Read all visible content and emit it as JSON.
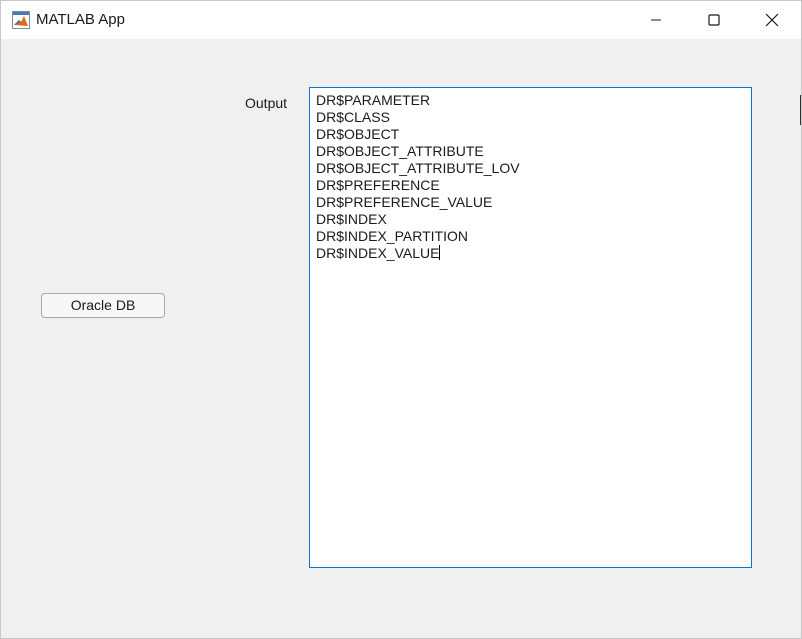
{
  "window": {
    "title": "MATLAB App",
    "app_icon": "matlab-logo-icon",
    "controls": [
      "minimize-icon",
      "maximize-icon",
      "close-icon"
    ]
  },
  "main": {
    "output_label": "Output",
    "oracle_button_label": "Oracle DB",
    "output_lines": [
      "DR$PARAMETER",
      "DR$CLASS",
      "DR$OBJECT",
      "DR$OBJECT_ATTRIBUTE",
      "DR$OBJECT_ATTRIBUTE_LOV",
      "DR$PREFERENCE",
      "DR$PREFERENCE_VALUE",
      "DR$INDEX",
      "DR$INDEX_PARTITION",
      "DR$INDEX_VALUE"
    ]
  },
  "colors": {
    "accent_border": "#0a74d4",
    "background": "#f0f0f0"
  }
}
